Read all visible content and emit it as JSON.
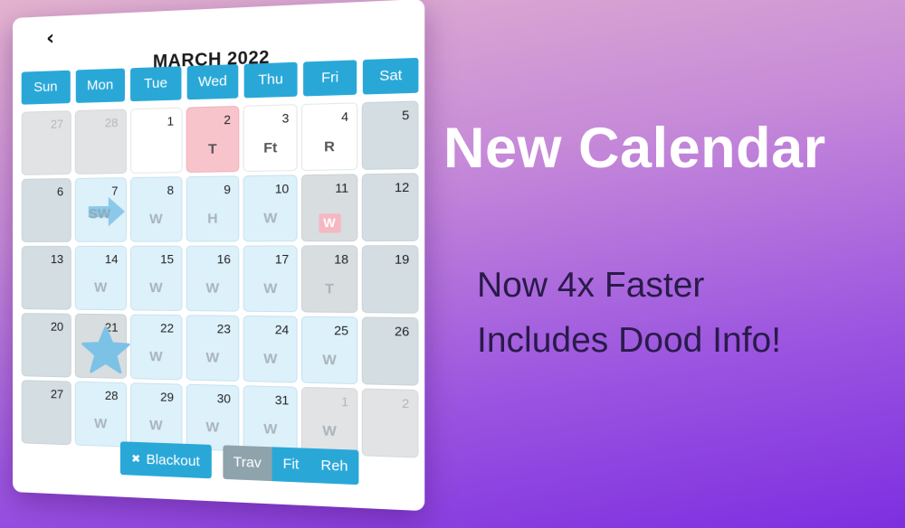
{
  "calendar": {
    "prev_glyph": "‹",
    "next_glyph": "›",
    "month_title": "MARCH 2022",
    "weekdays": [
      "Sun",
      "Mon",
      "Tue",
      "Wed",
      "Thu",
      "Fri",
      "Sat"
    ],
    "days": [
      {
        "num": "27",
        "type": "out",
        "code": ""
      },
      {
        "num": "28",
        "type": "out",
        "code": ""
      },
      {
        "num": "1",
        "type": "plain",
        "code": ""
      },
      {
        "num": "2",
        "type": "pink",
        "code": "T"
      },
      {
        "num": "3",
        "type": "plain",
        "code": "Ft"
      },
      {
        "num": "4",
        "type": "plain",
        "code": "R"
      },
      {
        "num": "5",
        "type": "weekend",
        "code": ""
      },
      {
        "num": "6",
        "type": "weekend",
        "code": ""
      },
      {
        "num": "7",
        "type": "travel",
        "code": "",
        "icon": "arrow-icon",
        "label": "SW"
      },
      {
        "num": "8",
        "type": "travel",
        "code": "W"
      },
      {
        "num": "9",
        "type": "travel",
        "code": "H"
      },
      {
        "num": "10",
        "type": "travel",
        "code": "W"
      },
      {
        "num": "11",
        "type": "gray",
        "code": "W",
        "marked": true
      },
      {
        "num": "12",
        "type": "weekend",
        "code": ""
      },
      {
        "num": "13",
        "type": "weekend",
        "code": ""
      },
      {
        "num": "14",
        "type": "travel",
        "code": "W"
      },
      {
        "num": "15",
        "type": "travel",
        "code": "W"
      },
      {
        "num": "16",
        "type": "travel",
        "code": "W"
      },
      {
        "num": "17",
        "type": "travel",
        "code": "W"
      },
      {
        "num": "18",
        "type": "gray",
        "code": "T"
      },
      {
        "num": "19",
        "type": "weekend",
        "code": ""
      },
      {
        "num": "20",
        "type": "weekend",
        "code": ""
      },
      {
        "num": "21",
        "type": "gray",
        "code": "",
        "icon": "star-icon"
      },
      {
        "num": "22",
        "type": "travel",
        "code": "W"
      },
      {
        "num": "23",
        "type": "travel",
        "code": "W"
      },
      {
        "num": "24",
        "type": "travel",
        "code": "W"
      },
      {
        "num": "25",
        "type": "travel",
        "code": "W"
      },
      {
        "num": "26",
        "type": "weekend",
        "code": ""
      },
      {
        "num": "27",
        "type": "weekend",
        "code": ""
      },
      {
        "num": "28",
        "type": "travel",
        "code": "W"
      },
      {
        "num": "29",
        "type": "travel",
        "code": "W"
      },
      {
        "num": "30",
        "type": "travel",
        "code": "W"
      },
      {
        "num": "31",
        "type": "travel",
        "code": "W"
      },
      {
        "num": "1",
        "type": "out",
        "code": "W"
      },
      {
        "num": "2",
        "type": "out",
        "code": ""
      }
    ],
    "blackout_label": "Blackout",
    "toggle": [
      {
        "label": "Trav",
        "active": false
      },
      {
        "label": "Fit",
        "active": true
      },
      {
        "label": "Reh",
        "active": true
      }
    ]
  },
  "promo": {
    "headline": "New Calendar",
    "line1": "Now 4x Faster",
    "line2": "Includes Dood Info!"
  },
  "colors": {
    "accent": "#29a8d8",
    "pink": "#f8c4cc",
    "travel": "#ddf1fb",
    "weekend": "#d3dde2"
  }
}
